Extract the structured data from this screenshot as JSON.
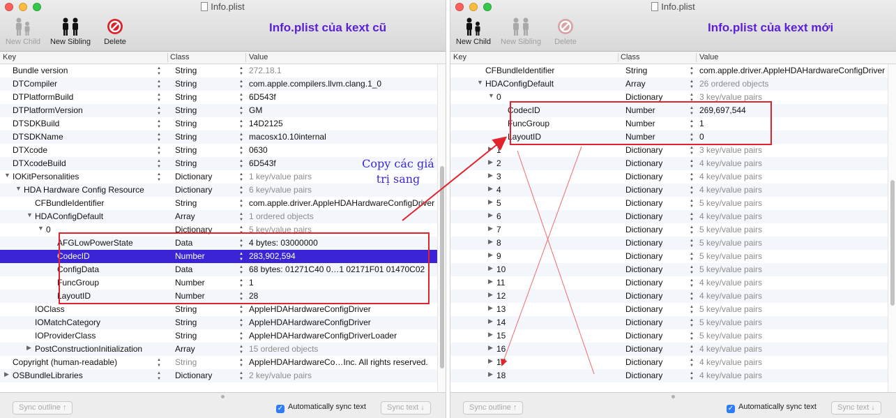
{
  "colors": {
    "accent": "#3b23d6",
    "note": "#5a1fd6",
    "highlight_box": "#e2222c"
  },
  "left": {
    "title": "Info.plist",
    "note": "Info.plist của kext cũ",
    "toolbar": [
      {
        "label": "New Child",
        "icon": "new-child-icon",
        "enabled": false
      },
      {
        "label": "New Sibling",
        "icon": "new-sibling-icon",
        "enabled": true
      },
      {
        "label": "Delete",
        "icon": "delete-icon",
        "enabled": true
      }
    ],
    "columns": {
      "key": "Key",
      "class": "Class",
      "value": "Value"
    },
    "rows": [
      {
        "key": "Bundle version",
        "cls": "String",
        "val": "272.18.1",
        "gray": true,
        "level": 0,
        "exp": ""
      },
      {
        "key": "DTCompiler",
        "cls": "String",
        "val": "com.apple.compilers.llvm.clang.1_0",
        "level": 0,
        "exp": ""
      },
      {
        "key": "DTPlatformBuild",
        "cls": "String",
        "val": "6D543f",
        "level": 0,
        "exp": ""
      },
      {
        "key": "DTPlatformVersion",
        "cls": "String",
        "val": "GM",
        "level": 0,
        "exp": ""
      },
      {
        "key": "DTSDKBuild",
        "cls": "String",
        "val": "14D2125",
        "level": 0,
        "exp": ""
      },
      {
        "key": "DTSDKName",
        "cls": "String",
        "val": "macosx10.10internal",
        "level": 0,
        "exp": ""
      },
      {
        "key": "DTXcode",
        "cls": "String",
        "val": "0630",
        "level": 0,
        "exp": ""
      },
      {
        "key": "DTXcodeBuild",
        "cls": "String",
        "val": "6D543f",
        "level": 0,
        "exp": ""
      },
      {
        "key": "IOKitPersonalities",
        "cls": "Dictionary",
        "val": "1 key/value pairs",
        "gray": true,
        "level": 0,
        "exp": "open"
      },
      {
        "key": "HDA Hardware Config Resource",
        "cls": "Dictionary",
        "val": "6 key/value pairs",
        "gray": true,
        "level": 1,
        "exp": "open"
      },
      {
        "key": "CFBundleIdentifier",
        "cls": "String",
        "val": "com.apple.driver.AppleHDAHardwareConfigDriver",
        "level": 2,
        "exp": ""
      },
      {
        "key": "HDAConfigDefault",
        "cls": "Array",
        "val": "1 ordered objects",
        "gray": true,
        "level": 2,
        "exp": "open"
      },
      {
        "key": "0",
        "cls": "Dictionary",
        "val": "5 key/value pairs",
        "gray": true,
        "level": 3,
        "exp": "open"
      },
      {
        "key": "AFGLowPowerState",
        "cls": "Data",
        "val": "4 bytes: 03000000",
        "level": 4,
        "exp": "",
        "prefix": "4 bytes: ",
        "prefixGray": true
      },
      {
        "key": "CodecID",
        "cls": "Number",
        "val": "283,902,594",
        "level": 4,
        "exp": "",
        "selected": true
      },
      {
        "key": "ConfigData",
        "cls": "Data",
        "val": "68 bytes: 01271C40 0…1 02171F01 01470C02",
        "level": 4,
        "exp": ""
      },
      {
        "key": "FuncGroup",
        "cls": "Number",
        "val": "1",
        "level": 4,
        "exp": ""
      },
      {
        "key": "LayoutID",
        "cls": "Number",
        "val": "28",
        "level": 4,
        "exp": ""
      },
      {
        "key": "IOClass",
        "cls": "String",
        "val": "AppleHDAHardwareConfigDriver",
        "level": 2,
        "exp": ""
      },
      {
        "key": "IOMatchCategory",
        "cls": "String",
        "val": "AppleHDAHardwareConfigDriver",
        "level": 2,
        "exp": ""
      },
      {
        "key": "IOProviderClass",
        "cls": "String",
        "val": "AppleHDAHardwareConfigDriverLoader",
        "level": 2,
        "exp": ""
      },
      {
        "key": "PostConstructionInitialization",
        "cls": "Array",
        "val": "15 ordered objects",
        "gray": true,
        "level": 2,
        "exp": "closed"
      },
      {
        "key": "Copyright (human-readable)",
        "cls": "String",
        "val": "AppleHDAHardwareCo…Inc. All rights reserved.",
        "clsGray": true,
        "level": 0,
        "exp": ""
      },
      {
        "key": "OSBundleLibraries",
        "cls": "Dictionary",
        "val": "2 key/value pairs",
        "gray": true,
        "level": 0,
        "exp": "closed"
      }
    ],
    "bottom": {
      "sync_outline": "Sync outline ↑",
      "auto_sync": "Automatically sync text",
      "sync_text": "Sync text ↓"
    }
  },
  "copy_note": "Copy các giá\ntrị sang",
  "right": {
    "title": "Info.plist",
    "note": "Info.plist của kext mới",
    "toolbar": [
      {
        "label": "New Child",
        "icon": "new-child-icon",
        "enabled": true
      },
      {
        "label": "New Sibling",
        "icon": "new-sibling-icon",
        "enabled": false
      },
      {
        "label": "Delete",
        "icon": "delete-icon",
        "enabled": false
      }
    ],
    "columns": {
      "key": "Key",
      "class": "Class",
      "value": "Value"
    },
    "rows": [
      {
        "key": "CFBundleIdentifier",
        "cls": "String",
        "val": "com.apple.driver.AppleHDAHardwareConfigDriver",
        "level": 2,
        "exp": ""
      },
      {
        "key": "HDAConfigDefault",
        "cls": "Array",
        "val": "26 ordered objects",
        "gray": true,
        "level": 2,
        "exp": "open"
      },
      {
        "key": "0",
        "cls": "Dictionary",
        "val": "3 key/value pairs",
        "gray": true,
        "level": 3,
        "exp": "open"
      },
      {
        "key": "CodecID",
        "cls": "Number",
        "val": "269,697,544",
        "level": 4,
        "exp": ""
      },
      {
        "key": "FuncGroup",
        "cls": "Number",
        "val": "1",
        "level": 4,
        "exp": ""
      },
      {
        "key": "LayoutID",
        "cls": "Number",
        "val": "0",
        "level": 4,
        "exp": ""
      },
      {
        "key": "1",
        "cls": "Dictionary",
        "val": "3 key/value pairs",
        "gray": true,
        "level": 3,
        "exp": "closed"
      },
      {
        "key": "2",
        "cls": "Dictionary",
        "val": "4 key/value pairs",
        "gray": true,
        "level": 3,
        "exp": "closed"
      },
      {
        "key": "3",
        "cls": "Dictionary",
        "val": "4 key/value pairs",
        "gray": true,
        "level": 3,
        "exp": "closed"
      },
      {
        "key": "4",
        "cls": "Dictionary",
        "val": "4 key/value pairs",
        "gray": true,
        "level": 3,
        "exp": "closed"
      },
      {
        "key": "5",
        "cls": "Dictionary",
        "val": "5 key/value pairs",
        "gray": true,
        "level": 3,
        "exp": "closed"
      },
      {
        "key": "6",
        "cls": "Dictionary",
        "val": "4 key/value pairs",
        "gray": true,
        "level": 3,
        "exp": "closed"
      },
      {
        "key": "7",
        "cls": "Dictionary",
        "val": "5 key/value pairs",
        "gray": true,
        "level": 3,
        "exp": "closed"
      },
      {
        "key": "8",
        "cls": "Dictionary",
        "val": "5 key/value pairs",
        "gray": true,
        "level": 3,
        "exp": "closed"
      },
      {
        "key": "9",
        "cls": "Dictionary",
        "val": "5 key/value pairs",
        "gray": true,
        "level": 3,
        "exp": "closed"
      },
      {
        "key": "10",
        "cls": "Dictionary",
        "val": "5 key/value pairs",
        "gray": true,
        "level": 3,
        "exp": "closed"
      },
      {
        "key": "11",
        "cls": "Dictionary",
        "val": "4 key/value pairs",
        "gray": true,
        "level": 3,
        "exp": "closed"
      },
      {
        "key": "12",
        "cls": "Dictionary",
        "val": "4 key/value pairs",
        "gray": true,
        "level": 3,
        "exp": "closed"
      },
      {
        "key": "13",
        "cls": "Dictionary",
        "val": "5 key/value pairs",
        "gray": true,
        "level": 3,
        "exp": "closed"
      },
      {
        "key": "14",
        "cls": "Dictionary",
        "val": "5 key/value pairs",
        "gray": true,
        "level": 3,
        "exp": "closed"
      },
      {
        "key": "15",
        "cls": "Dictionary",
        "val": "5 key/value pairs",
        "gray": true,
        "level": 3,
        "exp": "closed"
      },
      {
        "key": "16",
        "cls": "Dictionary",
        "val": "4 key/value pairs",
        "gray": true,
        "level": 3,
        "exp": "closed"
      },
      {
        "key": "17",
        "cls": "Dictionary",
        "val": "4 key/value pairs",
        "gray": true,
        "level": 3,
        "exp": "closed"
      },
      {
        "key": "18",
        "cls": "Dictionary",
        "val": "4 key/value pairs",
        "gray": true,
        "level": 3,
        "exp": "closed"
      }
    ],
    "bottom": {
      "sync_outline": "Sync outline ↑",
      "auto_sync": "Automatically sync text",
      "sync_text": "Sync text ↓"
    }
  }
}
